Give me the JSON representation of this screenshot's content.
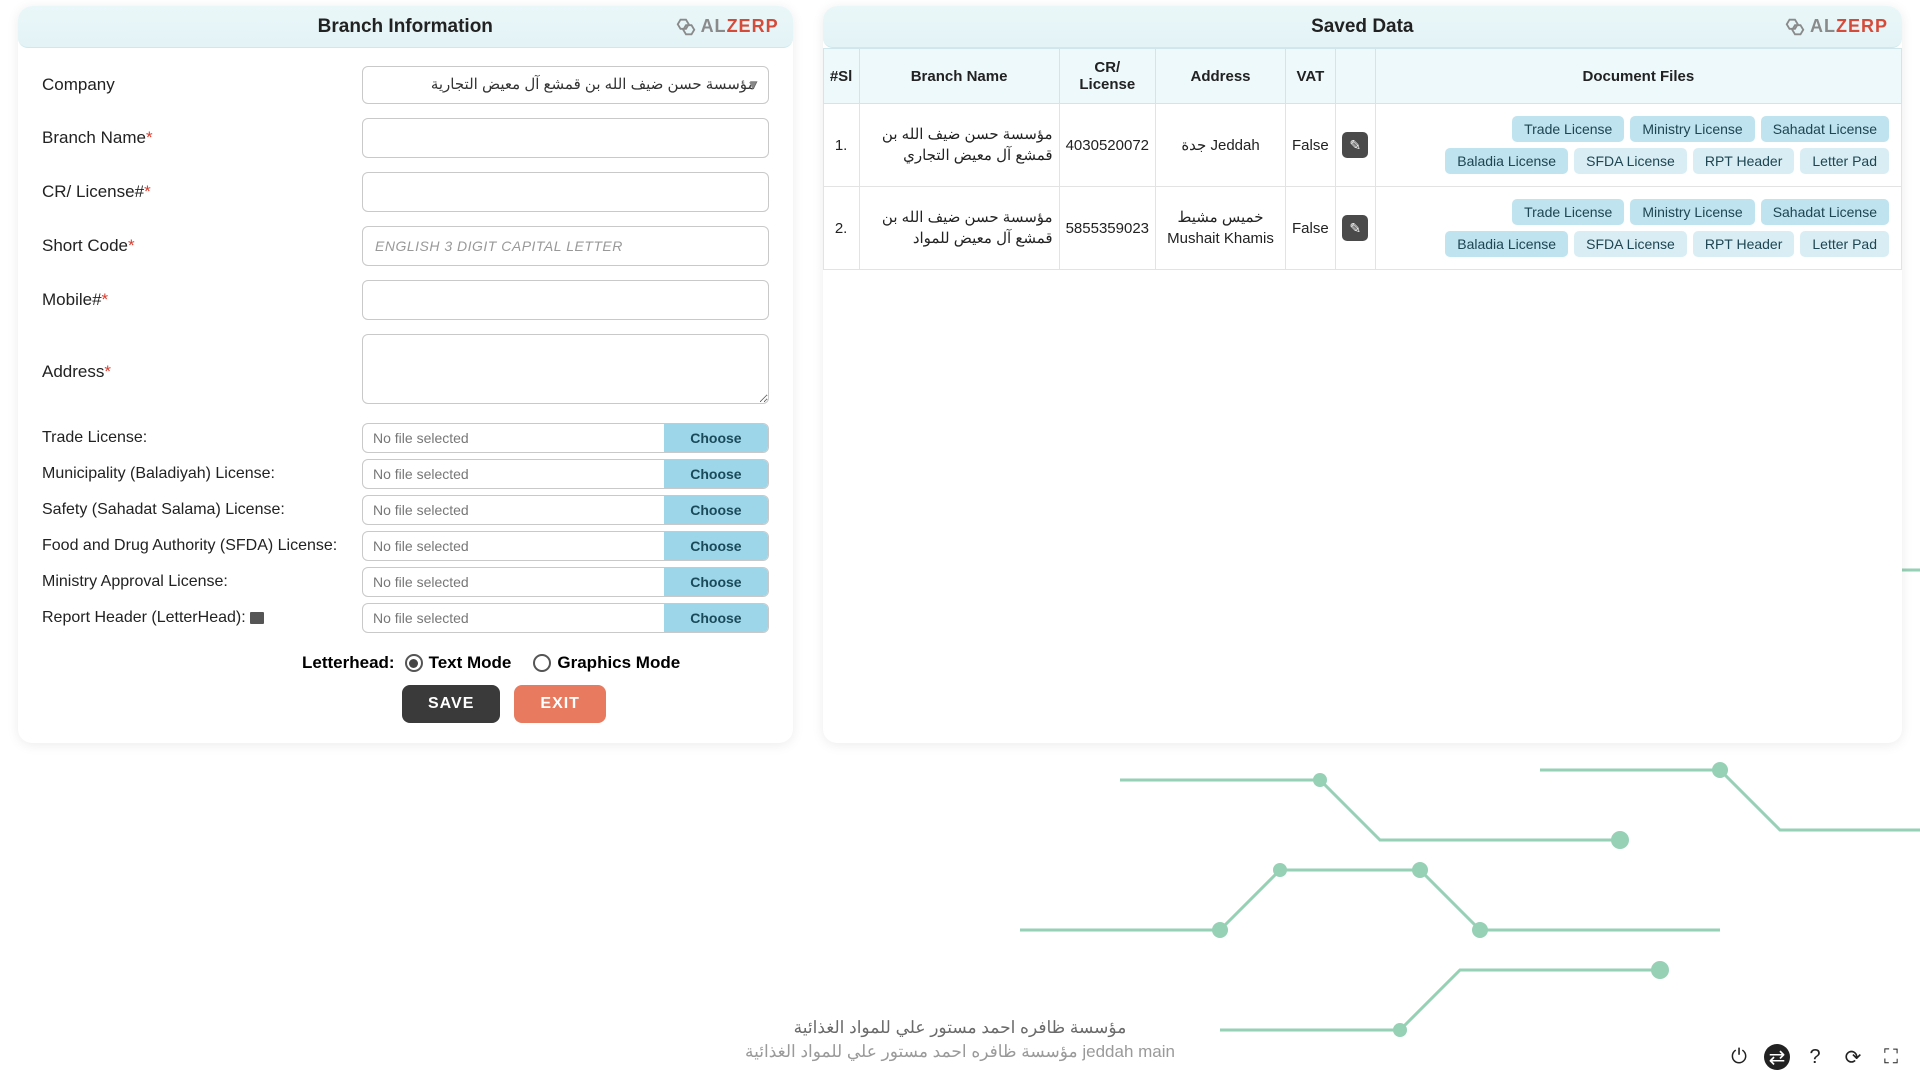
{
  "left_panel": {
    "title": "Branch Information",
    "logo": {
      "al": "AL",
      "zerp": "ZERP"
    },
    "fields": {
      "company": {
        "label": "Company",
        "value": "مؤسسة حسن ضيف الله بن قمشع آل معيض التجارية"
      },
      "branch_name": {
        "label": "Branch Name",
        "value": ""
      },
      "cr_license": {
        "label": "CR/ License#",
        "value": ""
      },
      "short_code": {
        "label": "Short Code",
        "value": "",
        "placeholder": "ENGLISH 3 DIGIT CAPITAL LETTER"
      },
      "mobile": {
        "label": "Mobile#",
        "value": ""
      },
      "address": {
        "label": "Address",
        "value": ""
      }
    },
    "file_fields": [
      {
        "label": "Trade License:",
        "text": "No file selected",
        "btn": "Choose"
      },
      {
        "label": "Municipality (Baladiyah) License:",
        "text": "No file selected",
        "btn": "Choose"
      },
      {
        "label": "Safety (Sahadat Salama) License:",
        "text": "No file selected",
        "btn": "Choose"
      },
      {
        "label": "Food and Drug Authority (SFDA) License:",
        "text": "No file selected",
        "btn": "Choose"
      },
      {
        "label": "Ministry Approval License:",
        "text": "No file selected",
        "btn": "Choose"
      },
      {
        "label": "Report Header (LetterHead):",
        "text": "No file selected",
        "btn": "Choose",
        "icon": true
      }
    ],
    "letterhead": {
      "label": "Letterhead:",
      "options": [
        {
          "label": "Text Mode",
          "checked": true
        },
        {
          "label": "Graphics Mode",
          "checked": false
        }
      ]
    },
    "buttons": {
      "save": "SAVE",
      "exit": "EXIT"
    }
  },
  "right_panel": {
    "title": "Saved Data",
    "logo": {
      "al": "AL",
      "zerp": "ZERP"
    },
    "columns": [
      "#Sl",
      "Branch Name",
      "CR/ License",
      "Address",
      "VAT",
      "",
      "Document Files"
    ],
    "rows": [
      {
        "sl": "1.",
        "branch_name": "مؤسسة حسن ضيف الله بن قمشع آل معيض التجاري",
        "cr": "4030520072",
        "address": "جدة Jeddah",
        "vat": "False",
        "docs": [
          "Trade License",
          "Ministry License",
          "Sahadat License",
          "Baladia License",
          "SFDA License",
          "RPT Header",
          "Letter Pad"
        ]
      },
      {
        "sl": "2.",
        "branch_name": "مؤسسة حسن ضيف الله بن قمشع آل معيض للمواد",
        "cr": "5855359023",
        "address": "خميس مشيط Mushait Khamis",
        "vat": "False",
        "docs": [
          "Trade License",
          "Ministry License",
          "Sahadat License",
          "Baladia License",
          "SFDA License",
          "RPT Header",
          "Letter Pad"
        ]
      }
    ]
  },
  "footer": {
    "line1": "مؤسسة ظافره احمد مستور علي للمواد الغذائية",
    "line2": "jeddah main مؤسسة ظافره احمد مستور علي للمواد الغذائية"
  }
}
